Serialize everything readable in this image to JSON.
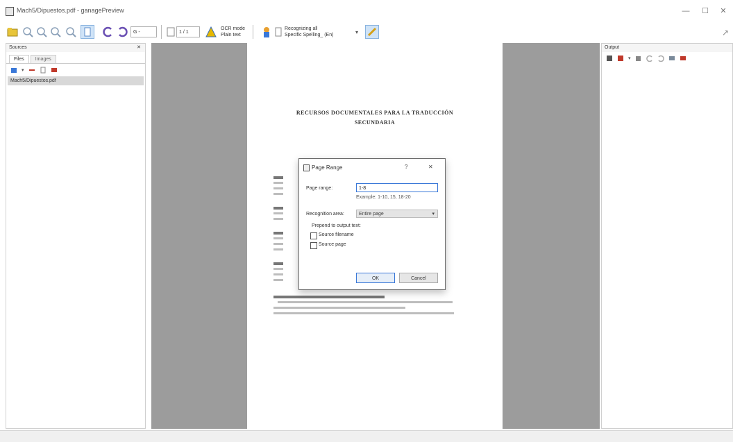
{
  "window": {
    "title": "Mach5/Dipuestos.pdf - ganagePreview",
    "minimize": "—",
    "maximize": "☐",
    "close": "✕"
  },
  "toolbar": {
    "zoom_box": "G -",
    "page_box": "1 / 1",
    "ocr_mode_line1": "OCR mode",
    "ocr_mode_line2": "Plain text",
    "recognition_line1": "Recognizing all",
    "recognition_line2": "Specific Spelling_ (En)",
    "icons": [
      "open-icon",
      "zoom-in-icon",
      "zoom-out-icon",
      "zoom-fit-icon",
      "select-icon",
      "rotate-left-icon",
      "rotate-right-icon",
      "page-navigation-icon",
      "recognize-icon",
      "settings-icon",
      "autocorrect-icon",
      "tools-icon"
    ]
  },
  "sources": {
    "header": "Sources",
    "tabs": [
      "Files",
      "Images"
    ],
    "files": [
      "Mach5/Dipuestos.pdf"
    ]
  },
  "output": {
    "header": "Output"
  },
  "document": {
    "title_line1": "RECURSOS DOCUMENTALES PARA LA TRADUCCIÓN",
    "title_line2": "SECUNDARIA"
  },
  "dialog": {
    "title": "Page Range",
    "help": "?",
    "close": "✕",
    "page_range_label": "Page range:",
    "page_range_value": "1-8",
    "example": "Example: 1-10, 15, 18-20",
    "recognition_area_label": "Recognition area:",
    "recognition_area_value": "Entire page",
    "prepend_label": "Prepend to output text:",
    "checkbox_source_filename": "Source filename",
    "checkbox_source_page": "Source page",
    "ok": "OK",
    "cancel": "Cancel"
  }
}
